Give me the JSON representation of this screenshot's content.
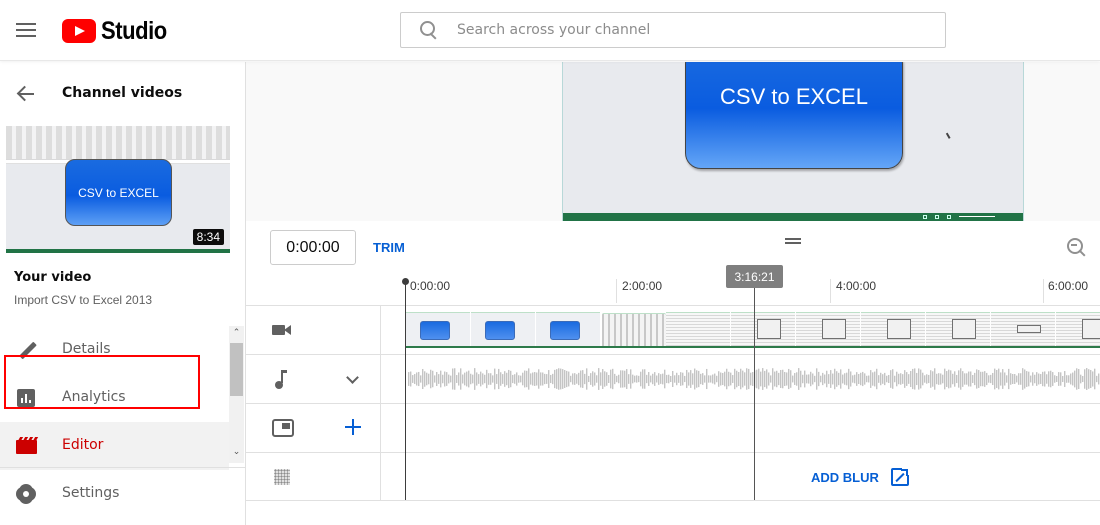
{
  "header": {
    "app_name": "Studio",
    "search_placeholder": "Search across your channel"
  },
  "sidebar": {
    "back_label": "Channel videos",
    "thumbnail": {
      "card_text": "CSV to EXCEL",
      "duration": "8:34"
    },
    "your_video_label": "Your video",
    "video_title": "Import CSV to Excel 2013",
    "items": [
      {
        "label": "Details",
        "icon": "pencil-icon",
        "active": false
      },
      {
        "label": "Analytics",
        "icon": "analytics-icon",
        "active": false
      },
      {
        "label": "Editor",
        "icon": "clapperboard-icon",
        "active": true
      },
      {
        "label": "Settings",
        "icon": "gear-icon",
        "active": false
      }
    ]
  },
  "preview": {
    "card_text": "CSV to EXCEL"
  },
  "editor": {
    "current_time": "0:00:00",
    "trim_label": "TRIM",
    "ruler_labels": [
      "0:00:00",
      "2:00:00",
      "4:00:00",
      "6:00:00"
    ],
    "hover_time": "3:16:21",
    "tracks": [
      {
        "name": "video",
        "icon": "video-camera-icon"
      },
      {
        "name": "audio",
        "icon": "music-note-icon",
        "control": "chevron-down-icon"
      },
      {
        "name": "end-screen",
        "icon": "end-screen-icon",
        "control": "plus-icon"
      },
      {
        "name": "blur",
        "icon": "blur-icon",
        "action_label": "ADD BLUR"
      }
    ],
    "colors": {
      "accent": "#065fd4",
      "active_nav": "#cc0000",
      "highlight_outline": "#ff0000"
    }
  }
}
